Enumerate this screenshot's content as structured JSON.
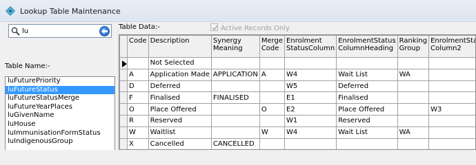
{
  "window": {
    "title": "Lookup Table Maintenance"
  },
  "search": {
    "value": "lu"
  },
  "labels": {
    "table_name": "Table Name:-",
    "table_data": "Table Data:-",
    "active_records": "Active Records Only"
  },
  "table_list": [
    {
      "label": "luFuturePriority",
      "selected": false
    },
    {
      "label": "luFutureStatus",
      "selected": true
    },
    {
      "label": "luFutureStatusMerge",
      "selected": false
    },
    {
      "label": "luFutureYearPlaces",
      "selected": false
    },
    {
      "label": "luGivenName",
      "selected": false
    },
    {
      "label": "luHouse",
      "selected": false
    },
    {
      "label": "luImmunisationFormStatus",
      "selected": false
    },
    {
      "label": "luIndigenousGroup",
      "selected": false
    }
  ],
  "grid": {
    "columns": [
      "Code",
      "Description",
      "Synergy Meaning",
      "Merge Code",
      "Enrolment StatusColumn",
      "EnrolmentStatus ColumnHeading",
      "Ranking Group",
      "EnrolmentStatus Column2"
    ],
    "rows": [
      [
        "",
        "Not Selected",
        "",
        "",
        "",
        "",
        "",
        ""
      ],
      [
        "A",
        "Application Made",
        "APPLICATION",
        "A",
        "W4",
        "Wait List",
        "WA",
        ""
      ],
      [
        "D",
        "Deferred",
        "",
        "",
        "W5",
        "Deferred",
        "",
        ""
      ],
      [
        "F",
        "Finalised",
        "FINALISED",
        "",
        "E1",
        "Finalised",
        "",
        ""
      ],
      [
        "O",
        "Place Offered",
        "",
        "O",
        "E2",
        "Place Offered",
        "",
        "W3"
      ],
      [
        "R",
        "Reserved",
        "",
        "",
        "W1",
        "Reserved",
        "",
        ""
      ],
      [
        "W",
        "Waitlist",
        "",
        "W",
        "W4",
        "Wait List",
        "WA",
        ""
      ],
      [
        "X",
        "Cancelled",
        "CANCELLED",
        "",
        "",
        "",
        "",
        ""
      ]
    ],
    "current_row": 0
  },
  "colors": {
    "selection": "#3399ff",
    "accent": "#1a5fc8"
  }
}
